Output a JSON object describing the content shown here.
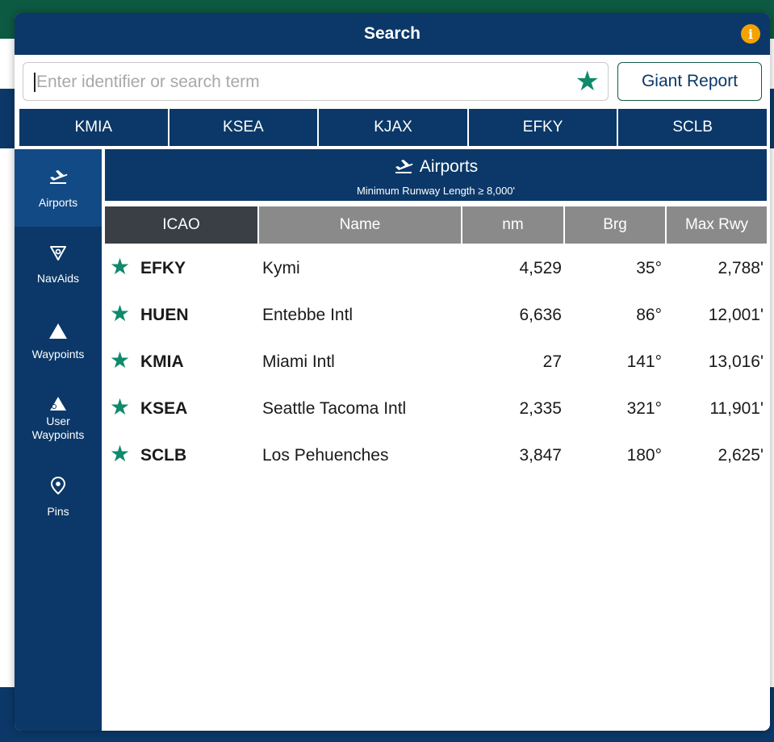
{
  "modal": {
    "title": "Search"
  },
  "search": {
    "placeholder": "Enter identifier or search term",
    "value": "",
    "report_label": "Giant Report"
  },
  "recent": [
    "KMIA",
    "KSEA",
    "KJAX",
    "EFKY",
    "SCLB"
  ],
  "sidebar": {
    "items": [
      {
        "label": "Airports",
        "icon": "airplane-departure-icon",
        "active": true
      },
      {
        "label": "NavAids",
        "icon": "navaid-icon"
      },
      {
        "label": "Waypoints",
        "icon": "waypoint-triangle-icon"
      },
      {
        "label": "User Waypoints",
        "icon": "user-waypoint-icon"
      },
      {
        "label": "Pins",
        "icon": "pin-icon"
      }
    ]
  },
  "category": {
    "title": "Airports",
    "subtitle": "Minimum Runway Length ≥ 8,000'"
  },
  "table": {
    "columns": [
      "ICAO",
      "Name",
      "nm",
      "Brg",
      "Max Rwy"
    ],
    "sorted_column": "ICAO",
    "rows": [
      {
        "icao": "EFKY",
        "name": "Kymi",
        "nm": "4,529",
        "brg": "35°",
        "rwy": "2,788'"
      },
      {
        "icao": "HUEN",
        "name": "Entebbe Intl",
        "nm": "6,636",
        "brg": "86°",
        "rwy": "12,001'"
      },
      {
        "icao": "KMIA",
        "name": "Miami Intl",
        "nm": "27",
        "brg": "141°",
        "rwy": "13,016'"
      },
      {
        "icao": "KSEA",
        "name": "Seattle Tacoma Intl",
        "nm": "2,335",
        "brg": "321°",
        "rwy": "11,901'"
      },
      {
        "icao": "SCLB",
        "name": "Los Pehuenches",
        "nm": "3,847",
        "brg": "180°",
        "rwy": "2,625'"
      }
    ]
  },
  "colors": {
    "navy": "#0b3868",
    "green_star": "#0f8a6b",
    "info": "#f5a200"
  }
}
